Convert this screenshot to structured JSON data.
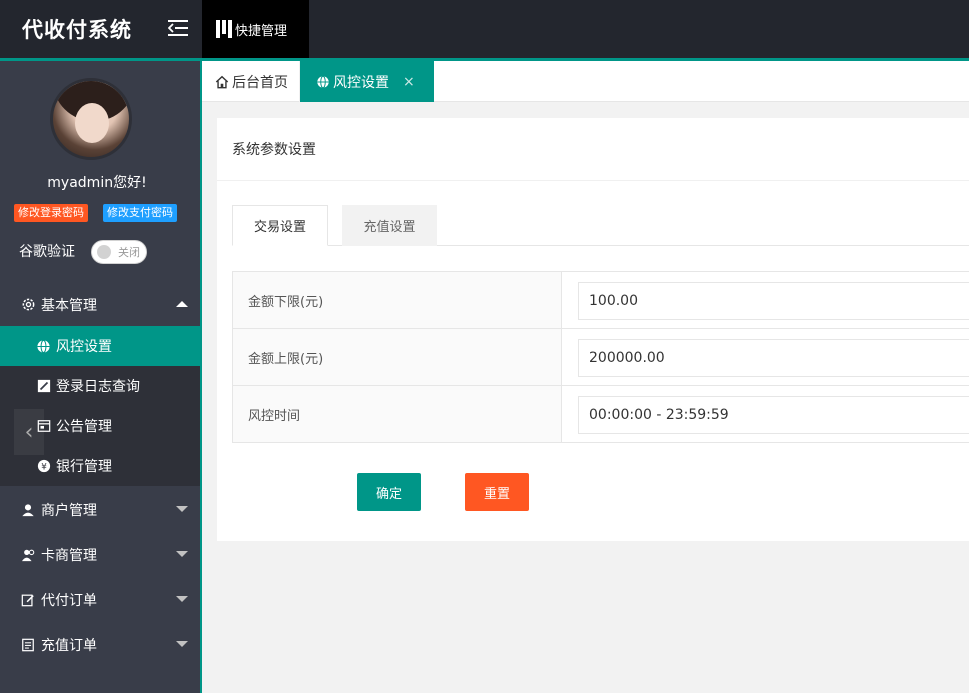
{
  "header": {
    "logo": "代收付系统",
    "quick_label": "快捷管理"
  },
  "user": {
    "greeting": "myadmin您好!",
    "change_login_pwd": "修改登录密码",
    "change_pay_pwd": "修改支付密码",
    "google_label": "谷歌验证",
    "google_switch": "关闭"
  },
  "sidebar": {
    "basic": "基本管理",
    "sub_items": [
      {
        "label": "风控设置"
      },
      {
        "label": "登录日志查询"
      },
      {
        "label": "公告管理"
      },
      {
        "label": "银行管理"
      }
    ],
    "items": [
      {
        "label": "商户管理"
      },
      {
        "label": "卡商管理"
      },
      {
        "label": "代付订单"
      },
      {
        "label": "充值订单"
      }
    ]
  },
  "tabs": {
    "home": "后台首页",
    "active": "风控设置",
    "close": "×"
  },
  "card": {
    "title": "系统参数设置",
    "tab_trade": "交易设置",
    "tab_recharge": "充值设置",
    "rows": [
      {
        "label": "金额下限(元)",
        "value": "100.00"
      },
      {
        "label": "金额上限(元)",
        "value": "200000.00"
      },
      {
        "label": "风控时间",
        "value": "00:00:00 - 23:59:59"
      }
    ],
    "btn_ok": "确定",
    "btn_reset": "重置"
  },
  "colors": {
    "accent": "#009688",
    "danger": "#ff5722",
    "info": "#1e9fff",
    "sidebar": "#393d49"
  }
}
